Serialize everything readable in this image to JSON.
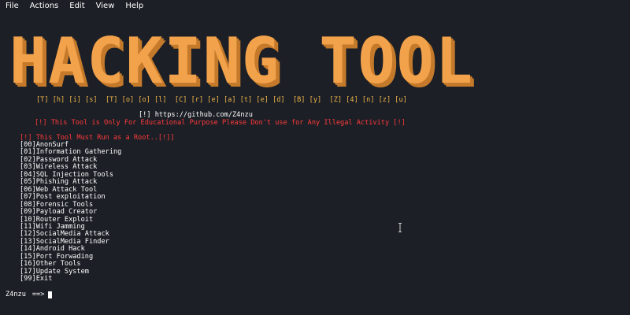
{
  "menubar": {
    "items": [
      "File",
      "Actions",
      "Edit",
      "View",
      "Help"
    ]
  },
  "banner": {
    "title": "HACKING TOOL",
    "subtitle": "[T] [h] [i] [s]  [T] [o] [o] [l]  [C] [r] [e] [a] [t] [e] [d]  [B] [y]  [Z] [4] [n] [z] [u]"
  },
  "info": {
    "github": "[!] https://github.com/Z4nzu",
    "disclaimer": "[!] This Tool is Only For Educational Purpose Please Don't use for Any Illegal Activity [!]",
    "root_warning": "[!] This Tool Must Run as a Root..[!]]"
  },
  "menu": [
    "[00]AnonSurf",
    "[01]Information Gathering",
    "[02]Password Attack",
    "[03]Wireless Attack",
    "[04]SQL Injection Tools",
    "[05]Phishing Attack",
    "[06]Web Attack Tool",
    "[07]Post exploitation",
    "[08]Forensic Tools",
    "[09]Payload Creator",
    "[10]Router Exploit",
    "[11]Wifi Jamming",
    "[12]SocialMedia Attack",
    "[13]SocialMedia Finder",
    "[14]Android Hack",
    "[15]Port Forwading",
    "[16]Other Tools",
    "[17]Update System",
    "[99]Exit"
  ],
  "prompt": {
    "user": "Z4nzu",
    "arrow": "==>"
  },
  "colors": {
    "background": "#1c1f26",
    "banner": "#f2a24b",
    "subtitle": "#f0b64a",
    "warning": "#ff3b3b",
    "text": "#ffffff"
  }
}
